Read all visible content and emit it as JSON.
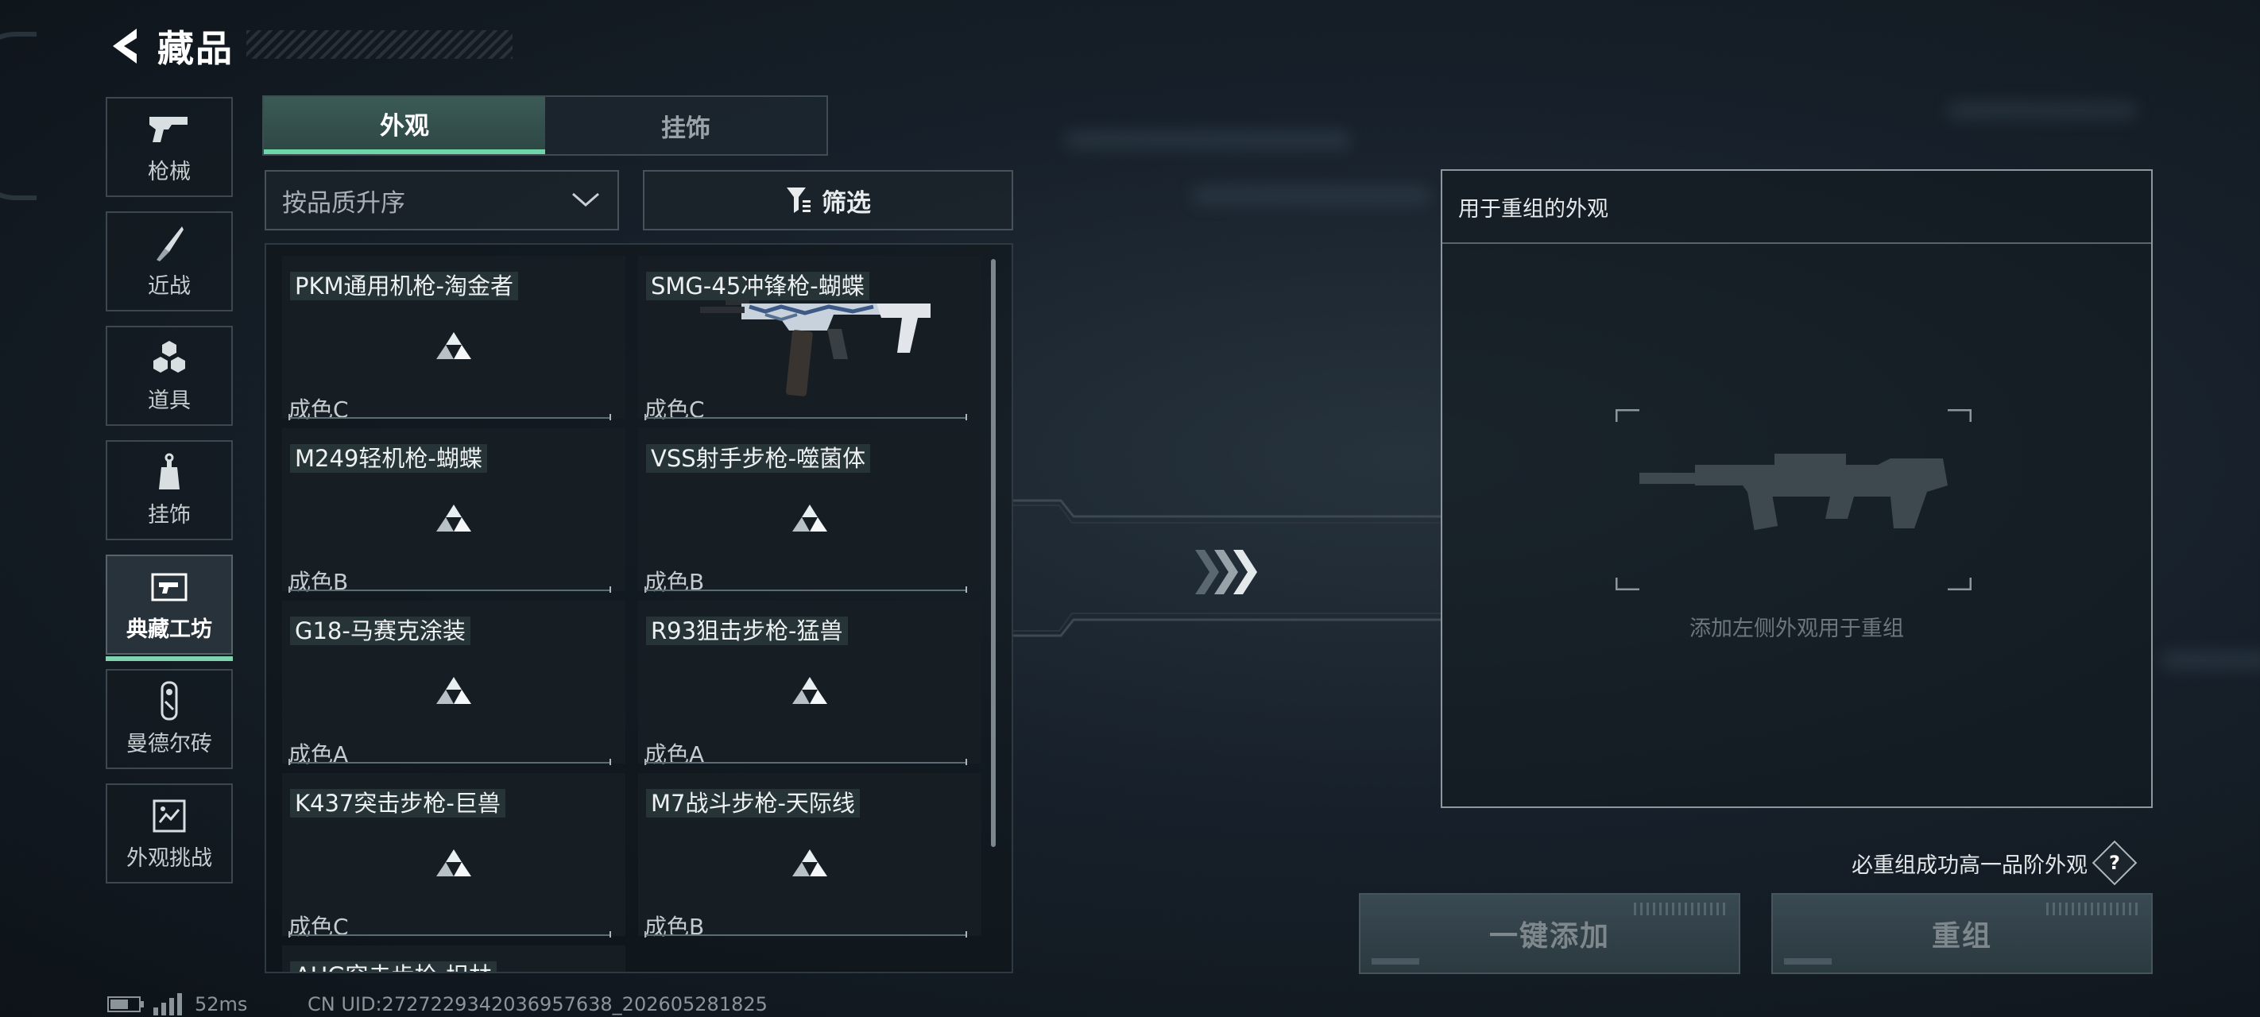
{
  "header": {
    "title": "藏品"
  },
  "nav": {
    "items": [
      {
        "label": "枪械",
        "icon": "pistol-icon"
      },
      {
        "label": "近战",
        "icon": "knife-icon"
      },
      {
        "label": "道具",
        "icon": "grenades-icon"
      },
      {
        "label": "挂饰",
        "icon": "charm-icon"
      },
      {
        "label": "典藏工坊",
        "icon": "workshop-icon",
        "active": true
      },
      {
        "label": "曼德尔砖",
        "icon": "mandel-brick-icon"
      },
      {
        "label": "外观挑战",
        "icon": "challenge-icon"
      }
    ]
  },
  "tabs": [
    {
      "label": "外观",
      "active": true
    },
    {
      "label": "挂饰",
      "active": false
    }
  ],
  "sort": {
    "value": "按品质升序"
  },
  "filter": {
    "label": "筛选"
  },
  "items": [
    {
      "name": "PKM通用机枪-淘金者",
      "grade": "成色C"
    },
    {
      "name": "SMG-45冲锋枪-蝴蝶",
      "grade": "成色C",
      "has_image": true
    },
    {
      "name": "M249轻机枪-蝴蝶",
      "grade": "成色B"
    },
    {
      "name": "VSS射手步枪-噬菌体",
      "grade": "成色B"
    },
    {
      "name": "G18-马赛克涂装",
      "grade": "成色A"
    },
    {
      "name": "R93狙击步枪-猛兽",
      "grade": "成色A"
    },
    {
      "name": "K437突击步枪-巨兽",
      "grade": "成色C"
    },
    {
      "name": "M7战斗步枪-天际线",
      "grade": "成色B"
    },
    {
      "name": "AUG突击步枪-坦林",
      "grade": ""
    }
  ],
  "recombine": {
    "header": "用于重组的外观",
    "hint": "添加左侧外观用于重组"
  },
  "guarantee": {
    "text": "必重组成功高一品阶外观",
    "help": "?"
  },
  "buttons": {
    "add_all": "一键添加",
    "recombine": "重组"
  },
  "status": {
    "ping": "52ms",
    "uid": "CN UID:2727229342036957638_202605281825"
  },
  "colors": {
    "accent": "#6fd6aa",
    "background": "#17202a"
  }
}
